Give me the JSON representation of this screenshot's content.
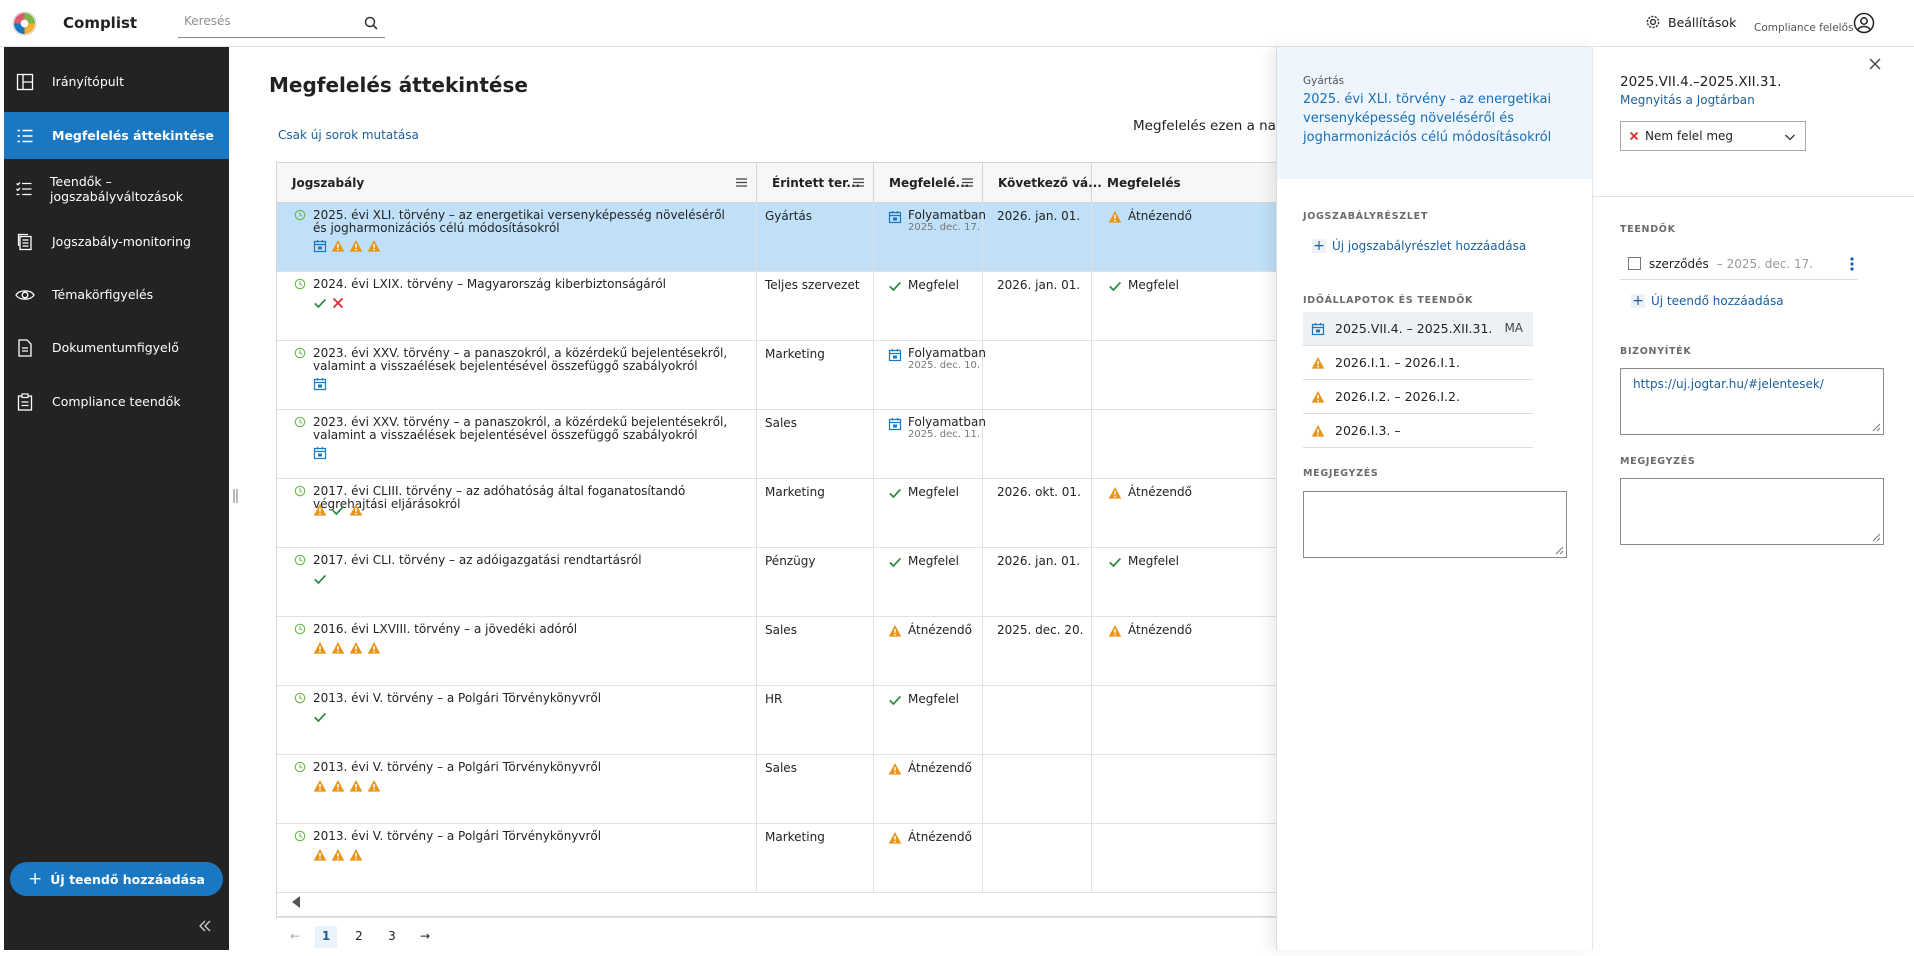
{
  "app": {
    "name": "Complist",
    "search_placeholder": "Keresés",
    "settings_label": "Beállítások",
    "role": "Compliance felelős"
  },
  "sidebar": {
    "items": [
      {
        "label": "Irányítópult",
        "icon": "dashboard-icon",
        "active": false
      },
      {
        "label": "Megfelelés áttekintése",
        "icon": "list-icon",
        "active": true
      },
      {
        "label": "Teendők – jogszabályváltozások",
        "icon": "checklist-icon",
        "active": false
      },
      {
        "label": "Jogszabály-monitoring",
        "icon": "documents-icon",
        "active": false
      },
      {
        "label": "Témakörfigyelés",
        "icon": "eye-icon",
        "active": false
      },
      {
        "label": "Dokumentumfigyelő",
        "icon": "document-icon",
        "active": false
      },
      {
        "label": "Compliance teendők",
        "icon": "clipboard-icon",
        "active": false
      }
    ],
    "add_task_label": "Új teendő hozzáadása"
  },
  "page": {
    "title": "Megfelelés áttekintése",
    "only_new_label": "Csak új sorok mutatása",
    "compliance_date_label": "Megfelelés ezen a napon"
  },
  "table": {
    "columns": [
      "Jogszabály",
      "Érintett ter...",
      "Megfelelé...",
      "Következő vá...",
      "Megfelelés"
    ],
    "rows": [
      {
        "law": "2025. évi XLI. törvény – az energetikai versenyképesség növeléséről és jogharmonizációs célú módosításokról",
        "icons": [
          "calendar",
          "warning",
          "warning",
          "warning"
        ],
        "area": "Gyártás",
        "status": "Folyamatban",
        "status_icon": "calendar",
        "status_date": "2025. dec. 17.",
        "next": "2026. jan. 01.",
        "compliance": "Átnézendő",
        "compliance_icon": "warning",
        "selected": true
      },
      {
        "law": "2024. évi LXIX. törvény – Magyarország kiberbiztonságáról",
        "icons": [
          "check",
          "cross"
        ],
        "area": "Teljes szervezet",
        "status": "Megfelel",
        "status_icon": "check",
        "status_date": "",
        "next": "2026. jan. 01.",
        "compliance": "Megfelel",
        "compliance_icon": "check",
        "selected": false
      },
      {
        "law": "2023. évi XXV. törvény – a panaszokról, a közérdekű bejelentésekről, valamint a visszaélések bejelentésével összefüggő szabályokról",
        "icons": [
          "calendar"
        ],
        "area": "Marketing",
        "status": "Folyamatban",
        "status_icon": "calendar",
        "status_date": "2025. dec. 10.",
        "next": "",
        "compliance": "",
        "compliance_icon": "",
        "selected": false
      },
      {
        "law": "2023. évi XXV. törvény – a panaszokról, a közérdekű bejelentésekről, valamint a visszaélések bejelentésével összefüggő szabályokról",
        "icons": [
          "calendar"
        ],
        "area": "Sales",
        "status": "Folyamatban",
        "status_icon": "calendar",
        "status_date": "2025. dec. 11.",
        "next": "",
        "compliance": "",
        "compliance_icon": "",
        "selected": false
      },
      {
        "law": "2017. évi CLIII. törvény – az adóhatóság által foganatosítandó végrehajtási eljárásokról",
        "icons": [
          "warning",
          "check",
          "warning"
        ],
        "area": "Marketing",
        "status": "Megfelel",
        "status_icon": "check",
        "status_date": "",
        "next": "2026. okt. 01.",
        "compliance": "Átnézendő",
        "compliance_icon": "warning",
        "selected": false
      },
      {
        "law": "2017. évi CLI. törvény – az adóigazgatási rendtartásról",
        "icons": [
          "check"
        ],
        "area": "Pénzügy",
        "status": "Megfelel",
        "status_icon": "check",
        "status_date": "",
        "next": "2026. jan. 01.",
        "compliance": "Megfelel",
        "compliance_icon": "check",
        "selected": false
      },
      {
        "law": "2016. évi LXVIII. törvény – a jövedéki adóról",
        "icons": [
          "warning",
          "warning",
          "warning",
          "warning"
        ],
        "area": "Sales",
        "status": "Átnézendő",
        "status_icon": "warning",
        "status_date": "",
        "next": "2025. dec. 20.",
        "compliance": "Átnézendő",
        "compliance_icon": "warning",
        "selected": false
      },
      {
        "law": "2013. évi V. törvény – a Polgári Törvénykönyvről",
        "icons": [
          "check"
        ],
        "area": "HR",
        "status": "Megfelel",
        "status_icon": "check",
        "status_date": "",
        "next": "",
        "compliance": "",
        "compliance_icon": "",
        "selected": false
      },
      {
        "law": "2013. évi V. törvény – a Polgári Törvénykönyvről",
        "icons": [
          "warning",
          "warning",
          "warning",
          "warning"
        ],
        "area": "Sales",
        "status": "Átnézendő",
        "status_icon": "warning",
        "status_date": "",
        "next": "",
        "compliance": "",
        "compliance_icon": "",
        "selected": false
      },
      {
        "law": "2013. évi V. törvény – a Polgári Törvénykönyvről",
        "icons": [
          "warning",
          "warning",
          "warning"
        ],
        "area": "Marketing",
        "status": "Átnézendő",
        "status_icon": "warning",
        "status_date": "",
        "next": "",
        "compliance": "",
        "compliance_icon": "",
        "selected": false
      }
    ],
    "pages": [
      "1",
      "2",
      "3"
    ],
    "current_page": "1"
  },
  "detail": {
    "category": "Gyártás",
    "law_title": "2025. évi XLI. törvény - az energetikai versenyképesség növeléséről és jogharmonizációs célú módosításokról",
    "section_detail": "JOGSZABÁLYRÉSZLET",
    "add_detail": "Új jogszabályrészlet hozzáadása",
    "section_periods": "IDŐÁLLAPOTOK ÉS TEENDŐK",
    "periods": [
      {
        "label": "2025.VII.4. – 2025.XII.31.",
        "icon": "calendar",
        "badge": "MA",
        "selected": true
      },
      {
        "label": "2026.I.1. – 2026.I.1.",
        "icon": "warning",
        "badge": "",
        "selected": false
      },
      {
        "label": "2026.I.2. – 2026.I.2.",
        "icon": "warning",
        "badge": "",
        "selected": false
      },
      {
        "label": "2026.I.3. –",
        "icon": "warning",
        "badge": "",
        "selected": false
      }
    ],
    "section_note": "MEGJEGYZÉS"
  },
  "period_detail": {
    "range": "2025.VII.4.–2025.XII.31.",
    "open_link": "Megnyitás a Jogtárban",
    "status_select": "Nem felel meg",
    "section_tasks": "TEENDŐK",
    "task": {
      "name": "szerződés",
      "date": "– 2025. dec. 17."
    },
    "add_task": "Új teendő hozzáadása",
    "section_evidence": "BIZONYÍTÉK",
    "evidence_value": "https://uj.jogtar.hu/#jelentesek/",
    "section_note": "MEGJEGYZÉS"
  },
  "colors": {
    "accent": "#1a78c2",
    "selected_row": "#bfe0f8",
    "warning": "#e8961b",
    "success": "#2a8a3e",
    "error": "#d92c2c",
    "sidebar": "#232323"
  }
}
